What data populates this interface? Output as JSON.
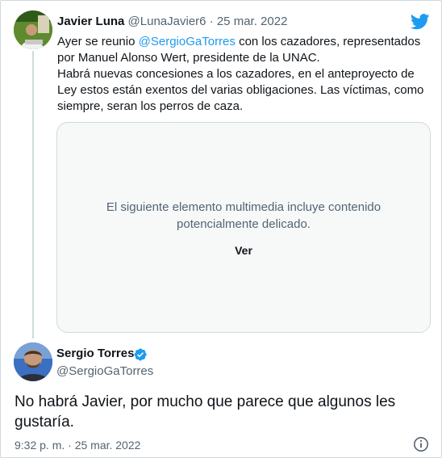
{
  "parent_tweet": {
    "author_name": "Javier Luna",
    "author_handle": "@LunaJavier6",
    "separator": "·",
    "date": "25 mar. 2022",
    "text_line1_before": "Ayer se reunio ",
    "text_line1_mention": "@SergioGaTorres",
    "text_line1_after": " con los cazadores, representados por Manuel Alonso Wert, presidente de la UNAC.",
    "text_line2": "Habrá nuevas concesiones a los cazadores, en el anteproyecto de Ley estos están exentos del varias obligaciones. Las víctimas, como siempre, seran los perros de caza.",
    "media": {
      "warning_line1": "El siguiente elemento multimedia incluye contenido",
      "warning_line2": "potencialmente delicado.",
      "view_label": "Ver"
    }
  },
  "main_tweet": {
    "author_name": "Sergio Torres",
    "author_handle": "@SergioGaTorres",
    "text": "No habrá Javier, por mucho que parece que algunos les gustaría.",
    "timestamp": "9:32 p. m. · 25 mar. 2022"
  },
  "icons": {
    "brand": "twitter-bird-icon",
    "verified": "verified-badge-icon",
    "info": "info-icon"
  },
  "colors": {
    "brand_blue": "#1d9bf0",
    "text_primary": "#0f1419",
    "text_secondary": "#536471",
    "border": "#cfd9de"
  }
}
